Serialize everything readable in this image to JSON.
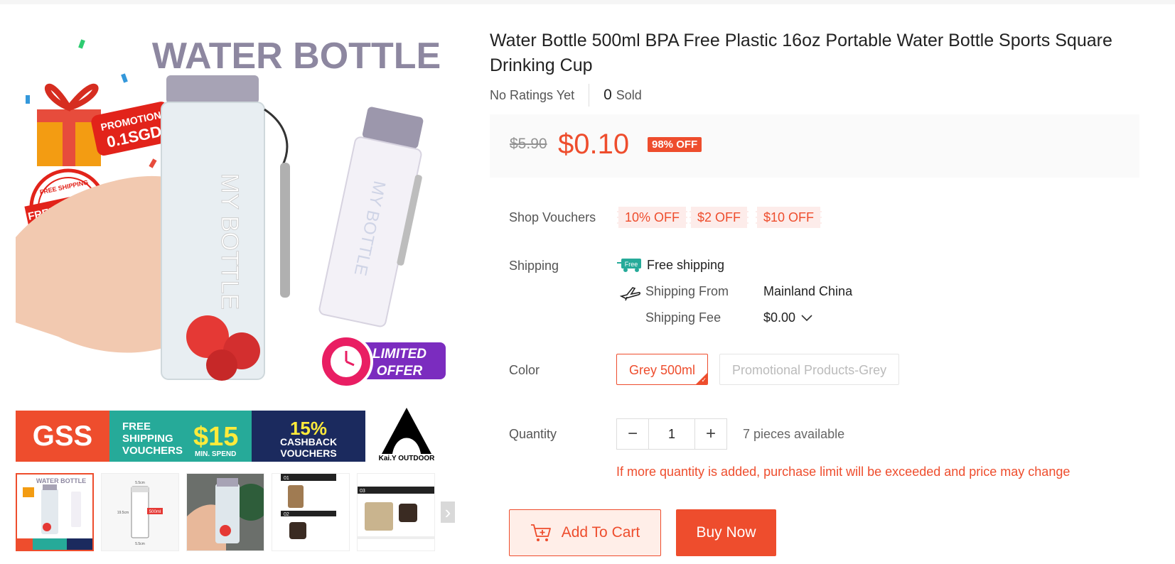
{
  "product": {
    "title": "Water Bottle 500ml BPA Free Plastic 16oz Portable Water Bottle Sports Square Drinking Cup",
    "ratings": "No Ratings Yet",
    "sold_count": "0",
    "sold_label": "Sold"
  },
  "gallery": {
    "banner": {
      "headline": "WATER BOTTLE",
      "promotion_top": "PROMOTION",
      "promotion_value": "0.1SGD",
      "free_shipping_1": "FREE SHIPPING",
      "free_shipping_2": "FREE SHIPPING",
      "bottle_text": "MY BOTTLE",
      "limited": "LIMITED",
      "offer": "OFFER",
      "gss": "GSS",
      "free_shipping_vouchers_1": "FREE",
      "free_shipping_vouchers_2": "SHIPPING",
      "free_shipping_vouchers_3": "VOUCHERS",
      "min_amount": "$15",
      "min_spend": "MIN. SPEND",
      "cashback_pct": "15%",
      "cashback_1": "CASHBACK",
      "cashback_2": "VOUCHERS",
      "brand": "Kai.Y OUTDOOR"
    },
    "thumbs": [
      {
        "label": "WATER BOTTLE"
      },
      {
        "label": "500ml",
        "dim_top": "5.5cm",
        "dim_side": "19.5cm",
        "dim_bottom": "5.5cm"
      },
      {
        "label": ""
      },
      {
        "label": "01",
        "label2": "02"
      },
      {
        "label": "03"
      }
    ],
    "next_icon": "›"
  },
  "price": {
    "original": "$5.90",
    "current": "$0.10",
    "discount": "98% OFF"
  },
  "vouchers": {
    "label": "Shop Vouchers",
    "items": [
      "10% OFF",
      "$2 OFF",
      "$10 OFF"
    ]
  },
  "shipping": {
    "label": "Shipping",
    "free_icon_text": "Free",
    "free_text": "Free shipping",
    "from_label": "Shipping From",
    "from_value": "Mainland China",
    "fee_label": "Shipping Fee",
    "fee_value": "$0.00"
  },
  "color": {
    "label": "Color",
    "options": [
      "Grey 500ml",
      "Promotional Products-Grey"
    ],
    "selected": "Grey 500ml"
  },
  "quantity": {
    "label": "Quantity",
    "value": "1",
    "minus": "−",
    "plus": "+",
    "available": "7 pieces available",
    "warning": "If more quantity is added, purchase limit will be exceeded and price may change"
  },
  "actions": {
    "add_to_cart": "Add To Cart",
    "buy_now": "Buy Now"
  },
  "colors": {
    "accent": "#ee4d2d",
    "teal": "#26aa99",
    "navy": "#1b2a5e"
  }
}
